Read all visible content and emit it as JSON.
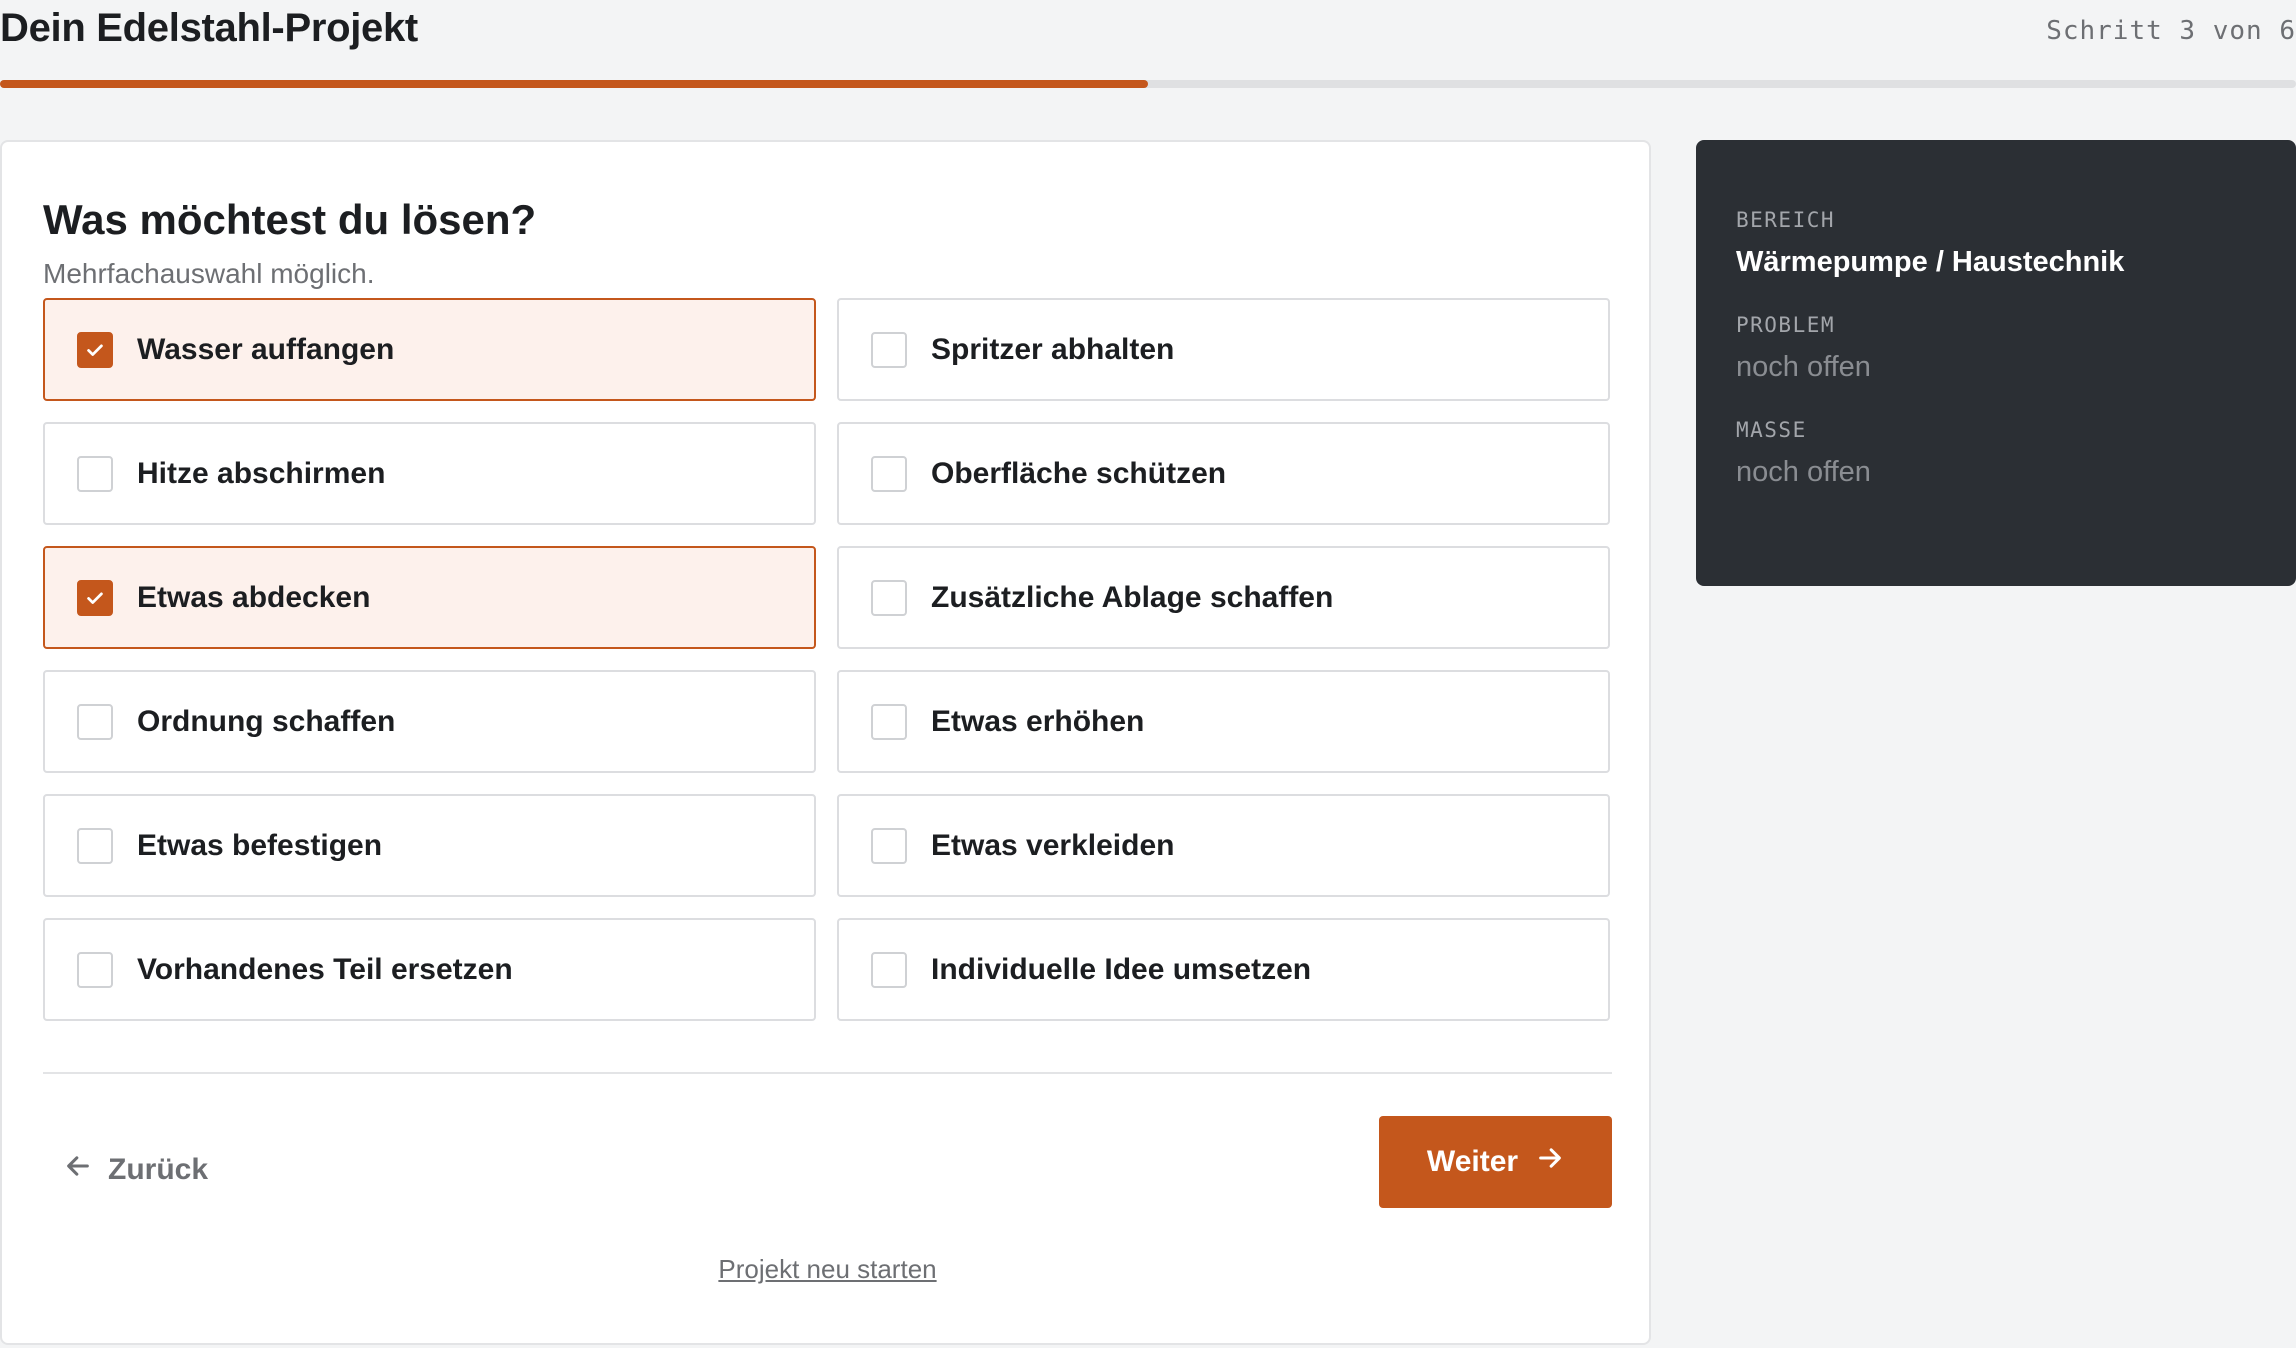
{
  "header": {
    "title": "Dein Edelstahl-Projekt",
    "step": "Schritt 3 von 6",
    "progress": 0.5
  },
  "question": {
    "title": "Was möchtest du lösen?",
    "hint": "Mehrfachauswahl möglich."
  },
  "options": [
    {
      "label": "Wasser auffangen",
      "selected": true
    },
    {
      "label": "Spritzer abhalten",
      "selected": false
    },
    {
      "label": "Hitze abschirmen",
      "selected": false
    },
    {
      "label": "Oberfläche schützen",
      "selected": false
    },
    {
      "label": "Etwas abdecken",
      "selected": true
    },
    {
      "label": "Zusätzliche Ablage schaffen",
      "selected": false
    },
    {
      "label": "Ordnung schaffen",
      "selected": false
    },
    {
      "label": "Etwas erhöhen",
      "selected": false
    },
    {
      "label": "Etwas befestigen",
      "selected": false
    },
    {
      "label": "Etwas verkleiden",
      "selected": false
    },
    {
      "label": "Vorhandenes Teil ersetzen",
      "selected": false
    },
    {
      "label": "Individuelle Idee umsetzen",
      "selected": false
    }
  ],
  "nav": {
    "back_label": "Zurück",
    "next_label": "Weiter",
    "restart_label": "Projekt neu starten"
  },
  "summary": {
    "area_label": "BEREICH",
    "area_value": "Wärmepumpe / Haustechnik",
    "problem_label": "PROBLEM",
    "problem_value": "noch offen",
    "measures_label": "MASSE",
    "measures_value": "noch offen"
  },
  "colors": {
    "accent": "#c4571c",
    "selected_bg": "#fdf1ec",
    "summary_bg": "#2b2f34"
  }
}
